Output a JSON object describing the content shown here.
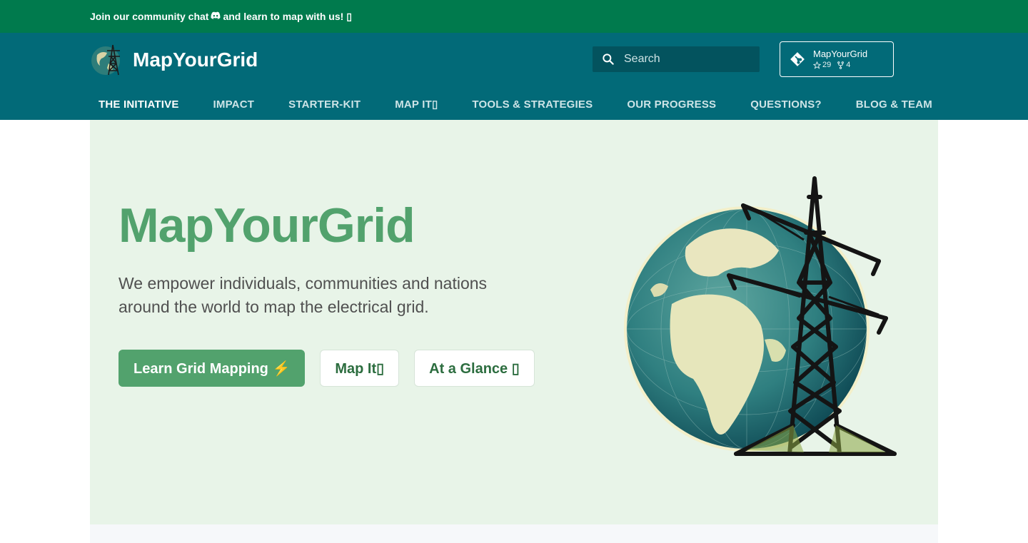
{
  "announcement": {
    "text_before": "Join our community chat",
    "discord_icon": "discord-icon",
    "text_after": "and learn to map with us!",
    "trailing_glyph": "▯"
  },
  "header": {
    "brand": "MapYourGrid",
    "logo_icon": "globe-pylon-logo-icon",
    "search": {
      "placeholder": "Search",
      "icon": "search-icon"
    },
    "repo": {
      "name": "MapYourGrid",
      "stars": "29",
      "forks": "4",
      "icon": "git-icon"
    }
  },
  "nav": {
    "items": [
      {
        "label": "THE INITIATIVE",
        "active": true
      },
      {
        "label": "IMPACT"
      },
      {
        "label": "STARTER-KIT"
      },
      {
        "label": "MAP IT▯"
      },
      {
        "label": "TOOLS & STRATEGIES"
      },
      {
        "label": "OUR PROGRESS"
      },
      {
        "label": "QUESTIONS?"
      },
      {
        "label": "BLOG & TEAM"
      }
    ]
  },
  "hero": {
    "title": "MapYourGrid",
    "subtitle": "We empower individuals, communities and nations around the world to map the electrical grid.",
    "buttons": {
      "learn": "Learn Grid Mapping ⚡",
      "map": "Map It▯",
      "glance": "At a Glance ▯"
    },
    "art_icon": "globe-power-tower-illustration"
  },
  "colors": {
    "announce_bg": "#007a4d",
    "header_bg": "#026a78",
    "hero_bg": "#e8f4e8",
    "accent_green": "#52a26d"
  }
}
